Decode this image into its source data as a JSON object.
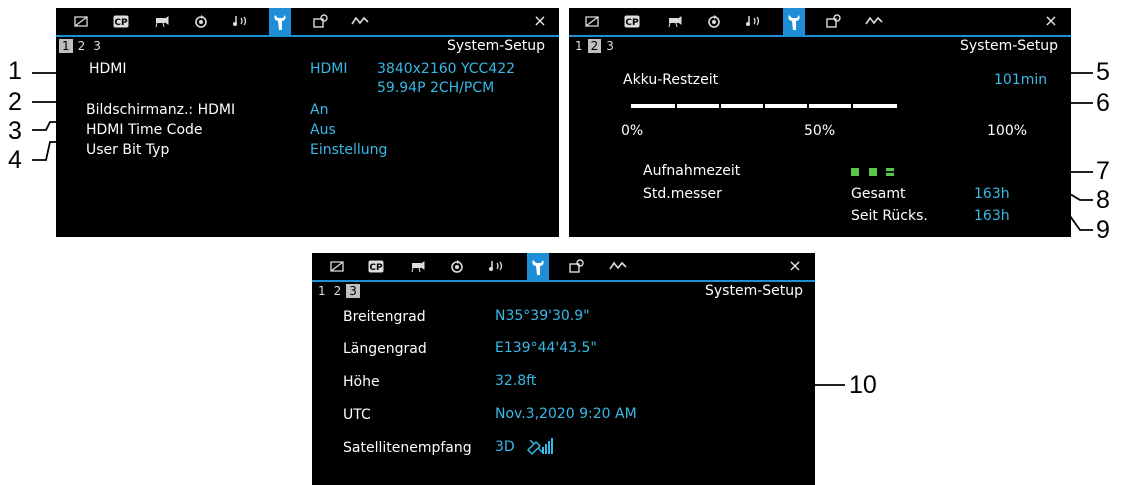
{
  "tabs": [
    {
      "name": "image-tab-icon"
    },
    {
      "name": "cp-tab-icon",
      "label": "CP"
    },
    {
      "name": "camera-tab-icon"
    },
    {
      "name": "record-tab-icon"
    },
    {
      "name": "audio-tab-icon"
    },
    {
      "name": "wrench-tab-icon"
    },
    {
      "name": "assign-tab-icon"
    },
    {
      "name": "my-menu-tab-icon"
    }
  ],
  "close_label": "×",
  "title": "System-Setup",
  "pages": [
    "1",
    "2",
    "3"
  ],
  "panel1": {
    "current_page": 0,
    "rows": [
      {
        "label": "HDMI",
        "value_a": "HDMI",
        "value_b": "3840x2160 YCC422",
        "value_c": "59.94P  2CH/PCM"
      },
      {
        "label": "Bildschirmanz.: HDMI",
        "value": "An"
      },
      {
        "label": "HDMI Time Code",
        "value": "Aus"
      },
      {
        "label": "User Bit Typ",
        "value": "Einstellung"
      }
    ]
  },
  "panel2": {
    "current_page": 1,
    "battery_label": "Akku-Restzeit",
    "battery_value": "101min",
    "battery_level_percent": 75,
    "scale": [
      "0%",
      "50%",
      "100%"
    ],
    "rec_time_label": "Aufnahmezeit",
    "rec_time_blocks": 3,
    "hour_meter_label": "Std.messer",
    "total_label": "Gesamt",
    "total_value": "163h",
    "since_reset_label": "Seit Rücks.",
    "since_reset_value": "163h"
  },
  "panel3": {
    "current_page": 2,
    "rows": [
      {
        "label": "Breitengrad",
        "value": "N35°39'30.9\""
      },
      {
        "label": "Längengrad",
        "value": "E139°44'43.5\""
      },
      {
        "label": "Höhe",
        "value": "32.8ft"
      },
      {
        "label": "UTC",
        "value": "Nov.3,2020 9:20 AM"
      },
      {
        "label": "Satellitenempfang",
        "value": "3D"
      }
    ],
    "satellite_icon": "satellite-signal-icon"
  },
  "callouts": [
    "1",
    "2",
    "3",
    "4",
    "5",
    "6",
    "7",
    "8",
    "9",
    "10"
  ],
  "colors": {
    "accent": "#1e8fd6",
    "value": "#39b9e8",
    "rec_block": "#5bc64e"
  }
}
